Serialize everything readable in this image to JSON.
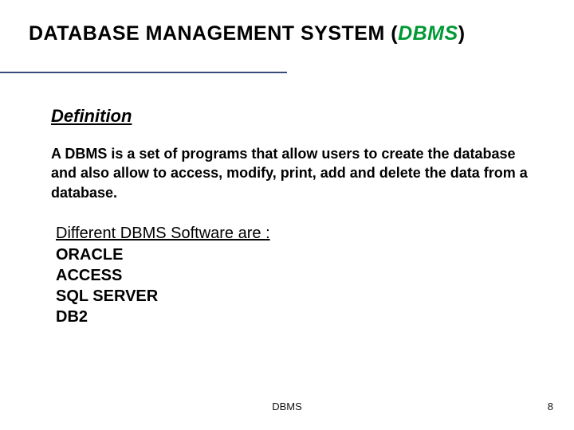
{
  "title": {
    "pre": "DATABASE MANAGEMENT SYSTEM (",
    "emph": "DBMS",
    "post": ")"
  },
  "definition": {
    "label": "Definition",
    "text": "A DBMS is a set of programs that allow users to create the database and also allow to access, modify, print, add and delete the data from a database."
  },
  "software": {
    "heading": "Different DBMS Software are :",
    "items": [
      "ORACLE",
      "ACCESS",
      "SQL SERVER",
      "DB2"
    ]
  },
  "footer": {
    "label": "DBMS",
    "page": "8"
  }
}
